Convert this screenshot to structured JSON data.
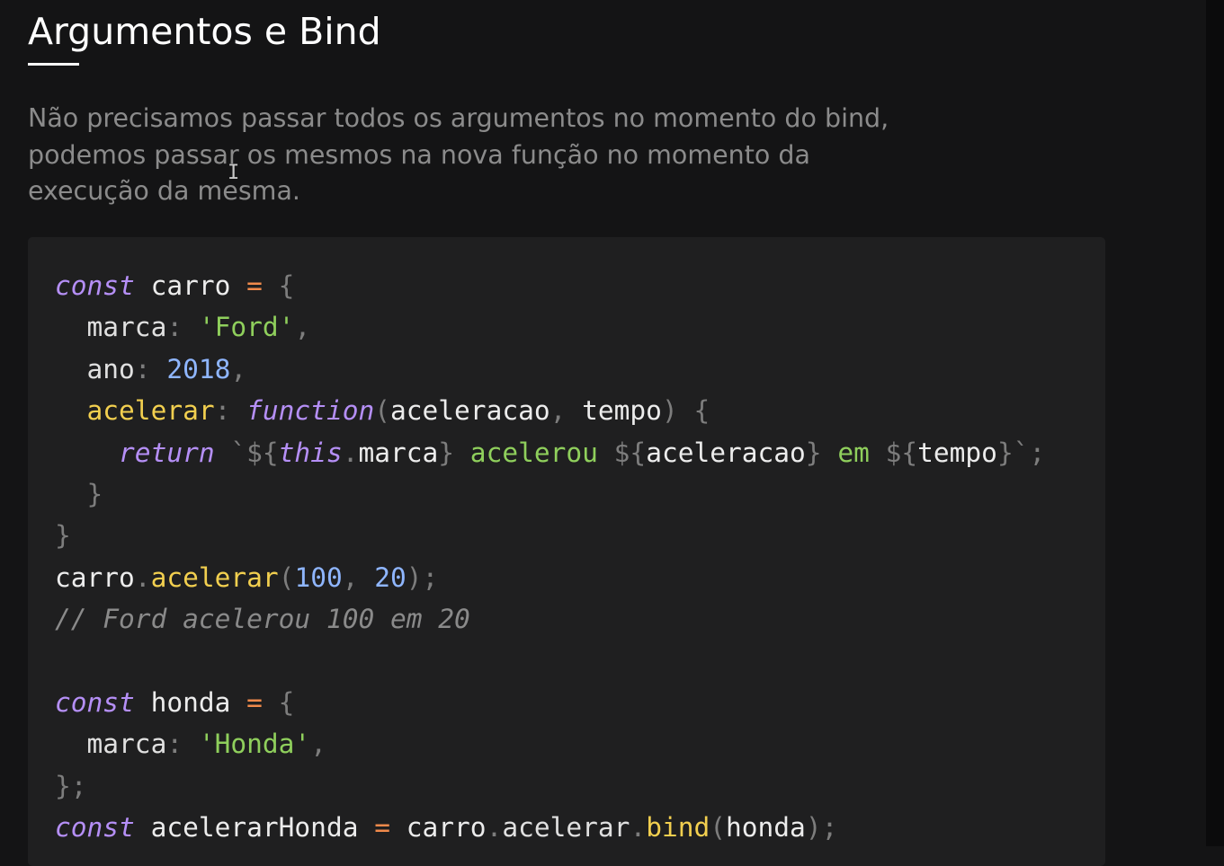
{
  "page": {
    "title": "Argumentos e Bind",
    "intro_lines": [
      "Não precisamos passar todos os argumentos no momento do bind,",
      "podemos passar os mesmos na nova função no momento da",
      "execução da mesma."
    ],
    "text_cursor_glyph": "I"
  },
  "code": {
    "lines": [
      [
        {
          "t": "kw",
          "v": "const"
        },
        {
          "t": "id",
          "v": " carro "
        },
        {
          "t": "op",
          "v": "="
        },
        {
          "t": "punc",
          "v": " {"
        }
      ],
      [
        {
          "t": "prop",
          "v": "  marca"
        },
        {
          "t": "punc",
          "v": ": "
        },
        {
          "t": "str",
          "v": "'Ford'"
        },
        {
          "t": "punc",
          "v": ","
        }
      ],
      [
        {
          "t": "prop",
          "v": "  ano"
        },
        {
          "t": "punc",
          "v": ": "
        },
        {
          "t": "num",
          "v": "2018"
        },
        {
          "t": "punc",
          "v": ","
        }
      ],
      [
        {
          "t": "fn",
          "v": "  acelerar"
        },
        {
          "t": "punc",
          "v": ": "
        },
        {
          "t": "kw",
          "v": "function"
        },
        {
          "t": "punc",
          "v": "("
        },
        {
          "t": "id",
          "v": "aceleracao"
        },
        {
          "t": "punc",
          "v": ", "
        },
        {
          "t": "id",
          "v": "tempo"
        },
        {
          "t": "punc",
          "v": ") {"
        }
      ],
      [
        {
          "t": "kw",
          "v": "    return"
        },
        {
          "t": "punc",
          "v": " `${"
        },
        {
          "t": "kw",
          "v": "this"
        },
        {
          "t": "punc",
          "v": "."
        },
        {
          "t": "id",
          "v": "marca"
        },
        {
          "t": "punc",
          "v": "}"
        },
        {
          "t": "str",
          "v": " acelerou "
        },
        {
          "t": "punc",
          "v": "${"
        },
        {
          "t": "id",
          "v": "aceleracao"
        },
        {
          "t": "punc",
          "v": "}"
        },
        {
          "t": "str",
          "v": " em "
        },
        {
          "t": "punc",
          "v": "${"
        },
        {
          "t": "id",
          "v": "tempo"
        },
        {
          "t": "punc",
          "v": "}`;"
        }
      ],
      [
        {
          "t": "punc",
          "v": "  }"
        }
      ],
      [
        {
          "t": "punc",
          "v": "}"
        }
      ],
      [
        {
          "t": "id",
          "v": "carro"
        },
        {
          "t": "punc",
          "v": "."
        },
        {
          "t": "fn",
          "v": "acelerar"
        },
        {
          "t": "punc",
          "v": "("
        },
        {
          "t": "num",
          "v": "100"
        },
        {
          "t": "punc",
          "v": ", "
        },
        {
          "t": "num",
          "v": "20"
        },
        {
          "t": "punc",
          "v": ");"
        }
      ],
      [
        {
          "t": "cm",
          "v": "// Ford acelerou 100 em 20"
        }
      ],
      [],
      [
        {
          "t": "kw",
          "v": "const"
        },
        {
          "t": "id",
          "v": " honda "
        },
        {
          "t": "op",
          "v": "="
        },
        {
          "t": "punc",
          "v": " {"
        }
      ],
      [
        {
          "t": "prop",
          "v": "  marca"
        },
        {
          "t": "punc",
          "v": ": "
        },
        {
          "t": "str",
          "v": "'Honda'"
        },
        {
          "t": "punc",
          "v": ","
        }
      ],
      [
        {
          "t": "punc",
          "v": "};"
        }
      ],
      [
        {
          "t": "kw",
          "v": "const"
        },
        {
          "t": "id",
          "v": " acelerarHonda "
        },
        {
          "t": "op",
          "v": "="
        },
        {
          "t": "id",
          "v": " carro"
        },
        {
          "t": "punc",
          "v": "."
        },
        {
          "t": "prop",
          "v": "acelerar"
        },
        {
          "t": "punc",
          "v": "."
        },
        {
          "t": "fn",
          "v": "bind"
        },
        {
          "t": "punc",
          "v": "("
        },
        {
          "t": "id",
          "v": "honda"
        },
        {
          "t": "punc",
          "v": ");"
        }
      ]
    ]
  },
  "colors": {
    "background": "#141415",
    "code_background": "#1f1f20",
    "title": "#ffffff",
    "intro_text": "#8b8b8b",
    "keyword": "#b58ff6",
    "string": "#8fcf5c",
    "number": "#8fb6ff",
    "function_name": "#f2cf4f",
    "operator": "#f08a4b",
    "punctuation": "#7d7d7d",
    "comment": "#8a8a8a"
  }
}
